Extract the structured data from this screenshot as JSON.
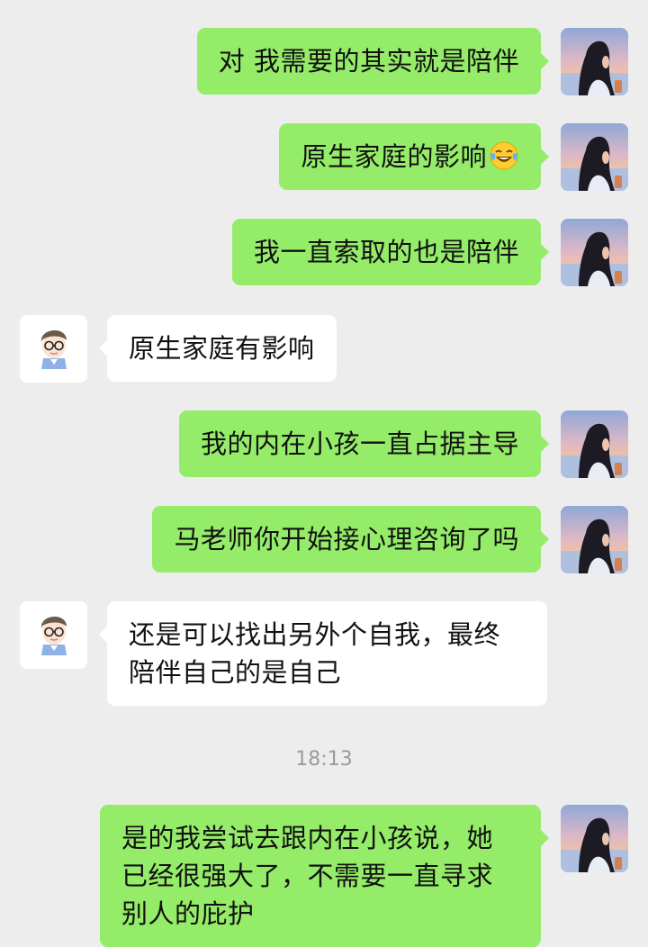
{
  "messages": [
    {
      "sender": "self",
      "text": "对 我需要的其实就是陪伴"
    },
    {
      "sender": "self",
      "text": "原生家庭的影响",
      "emoji": "face-with-tears-of-joy"
    },
    {
      "sender": "self",
      "text": "我一直索取的也是陪伴"
    },
    {
      "sender": "other",
      "text": "原生家庭有影响"
    },
    {
      "sender": "self",
      "text": "我的内在小孩一直占据主导"
    },
    {
      "sender": "self",
      "text": "马老师你开始接心理咨询了吗"
    },
    {
      "sender": "other",
      "text": "还是可以找出另外个自我，最终\n陪伴自己的是自己"
    },
    {
      "sender": "self",
      "text": "是的我尝试去跟内在小孩说，她\n已经很强大了，不需要一直寻求\n别人的庇护"
    }
  ],
  "timestamp": "18:13",
  "colors": {
    "background": "#ededed",
    "self_bubble": "#95ec69",
    "other_bubble": "#ffffff",
    "timestamp_text": "#9b9b9b"
  },
  "icons": {
    "self_avatar": "girl-sunset-photo-avatar",
    "other_avatar": "cartoon-man-glasses-avatar",
    "emoji": "face-with-tears-of-joy"
  }
}
